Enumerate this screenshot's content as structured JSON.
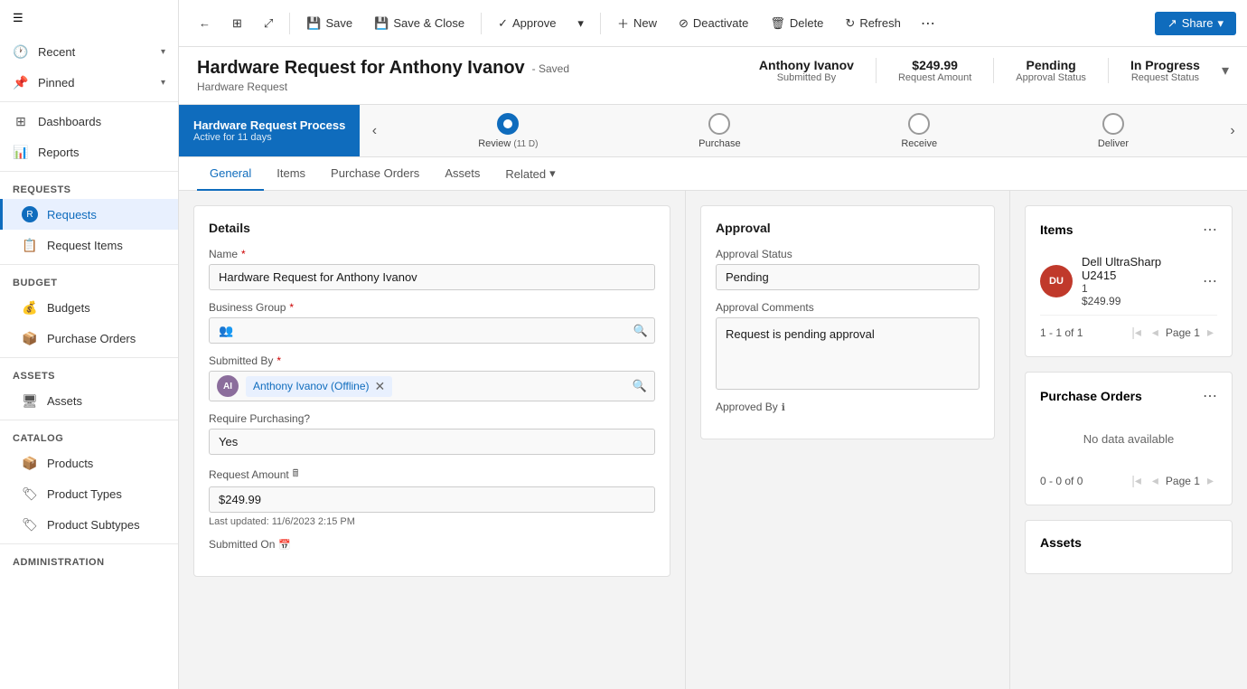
{
  "sidebar": {
    "menu_icon": "☰",
    "sections": [
      {
        "id": "recent",
        "label": "Recent",
        "icon": "🕐",
        "hasChevron": true
      },
      {
        "id": "pinned",
        "label": "Pinned",
        "icon": "📌",
        "hasChevron": true
      }
    ],
    "groups": [
      {
        "label": "Dashboards",
        "items": []
      },
      {
        "label": "Reports",
        "items": []
      },
      {
        "label": "Requests",
        "items": [
          {
            "id": "requests",
            "label": "Requests",
            "active": true
          },
          {
            "id": "request-items",
            "label": "Request Items",
            "active": false
          }
        ]
      },
      {
        "label": "Budget",
        "items": [
          {
            "id": "budgets",
            "label": "Budgets",
            "active": false
          },
          {
            "id": "purchase-orders",
            "label": "Purchase Orders",
            "active": false
          }
        ]
      },
      {
        "label": "Assets",
        "items": [
          {
            "id": "assets",
            "label": "Assets",
            "active": false
          }
        ]
      },
      {
        "label": "Catalog",
        "items": [
          {
            "id": "products",
            "label": "Products",
            "active": false
          },
          {
            "id": "product-types",
            "label": "Product Types",
            "active": false
          },
          {
            "id": "product-subtypes",
            "label": "Product Subtypes",
            "active": false
          }
        ]
      },
      {
        "label": "Administration",
        "items": []
      }
    ]
  },
  "toolbar": {
    "back_label": "←",
    "grid_label": "⊞",
    "expand_label": "⤢",
    "save_label": "Save",
    "save_close_label": "Save & Close",
    "approve_label": "Approve",
    "new_label": "New",
    "deactivate_label": "Deactivate",
    "delete_label": "Delete",
    "refresh_label": "Refresh",
    "more_label": "⋯",
    "share_label": "Share"
  },
  "record": {
    "title": "Hardware Request for Anthony Ivanov",
    "saved_status": "- Saved",
    "type": "Hardware Request",
    "submitted_by": "Anthony Ivanov",
    "submitted_by_label": "Submitted By",
    "amount": "$249.99",
    "amount_label": "Request Amount",
    "approval_status": "Pending",
    "approval_status_label": "Approval Status",
    "request_status": "In Progress",
    "request_status_label": "Request Status"
  },
  "process": {
    "active_label": "Hardware Request Process",
    "active_sub": "Active for 11 days",
    "steps": [
      {
        "id": "review",
        "label": "Review",
        "days": "(11 D)",
        "active": true
      },
      {
        "id": "purchase",
        "label": "Purchase",
        "days": "",
        "active": false
      },
      {
        "id": "receive",
        "label": "Receive",
        "days": "",
        "active": false
      },
      {
        "id": "deliver",
        "label": "Deliver",
        "days": "",
        "active": false
      }
    ]
  },
  "tabs": {
    "items": [
      {
        "id": "general",
        "label": "General",
        "active": true
      },
      {
        "id": "items",
        "label": "Items",
        "active": false
      },
      {
        "id": "purchase-orders",
        "label": "Purchase Orders",
        "active": false
      },
      {
        "id": "assets",
        "label": "Assets",
        "active": false
      },
      {
        "id": "related",
        "label": "Related",
        "active": false
      }
    ]
  },
  "details": {
    "section_title": "Details",
    "name_label": "Name",
    "name_value": "Hardware Request for Anthony Ivanov",
    "business_group_label": "Business Group",
    "business_group_icon": "👥",
    "submitted_by_label": "Submitted By",
    "submitted_by_name": "Anthony Ivanov (Offline)",
    "submitted_by_initials": "AI",
    "require_purchasing_label": "Require Purchasing?",
    "require_purchasing_value": "Yes",
    "request_amount_label": "Request Amount",
    "request_amount_value": "$249.99",
    "last_updated_label": "Last updated:",
    "last_updated_value": "11/6/2023 2:15 PM",
    "submitted_on_label": "Submitted On"
  },
  "approval": {
    "section_title": "Approval",
    "status_label": "Approval Status",
    "status_value": "Pending",
    "comments_label": "Approval Comments",
    "comments_value": "Request is pending approval",
    "approved_by_label": "Approved By"
  },
  "items_panel": {
    "title": "Items",
    "item": {
      "name": "Dell UltraSharp U2415",
      "quantity": "1",
      "price": "$249.99",
      "initials": "DU"
    },
    "pagination": "1 - 1 of 1",
    "page_label": "Page 1"
  },
  "purchase_orders_panel": {
    "title": "Purchase Orders",
    "no_data": "No data available",
    "pagination": "0 - 0 of 0",
    "page_label": "Page 1"
  },
  "assets_panel": {
    "title": "Assets"
  }
}
